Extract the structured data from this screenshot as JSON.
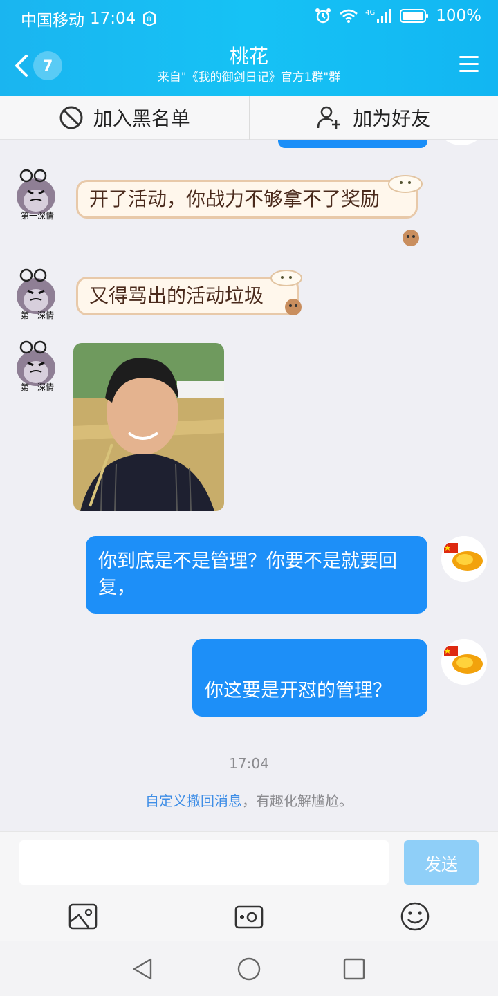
{
  "status_bar": {
    "carrier": "中国移动",
    "time": "17:04",
    "network": "4G",
    "battery": "100%"
  },
  "header": {
    "unread_count": "7",
    "title": "桃花",
    "subtitle": "来自\"《我的御剑日记》官方1群\"群"
  },
  "actions": {
    "blacklist_label": "加入黑名单",
    "add_friend_label": "加为好友"
  },
  "messages": [
    {
      "side": "left",
      "type": "text",
      "text": "开了活动，你战力不够拿不了奖励"
    },
    {
      "side": "left",
      "type": "text",
      "text": "又得骂出的活动垃圾"
    },
    {
      "side": "left",
      "type": "image"
    },
    {
      "side": "right",
      "type": "text",
      "text": "你到底是不是管理？你要不是就要回复，"
    },
    {
      "side": "right",
      "type": "text",
      "text": "你这要是开怼的管理？"
    }
  ],
  "chat_meta": {
    "timestamp": "17:04",
    "tip_link": "自定义撤回消息",
    "tip_text": "，有趣化解尴尬。"
  },
  "composer": {
    "input_value": "",
    "send_label": "发送",
    "tools": [
      "image-icon",
      "camera-icon",
      "emoji-icon"
    ]
  },
  "colors": {
    "header": "#16c2f5",
    "bubble_right": "#1d8ff8",
    "send_disabled": "#8fcff8",
    "link": "#3f8ee6"
  }
}
